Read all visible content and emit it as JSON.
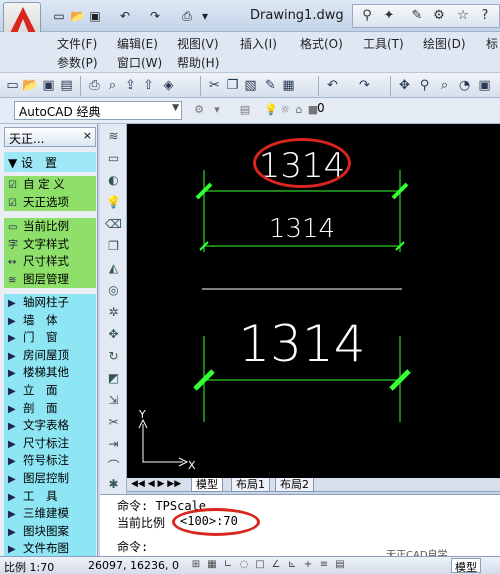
{
  "app": {
    "logo": "autocad-logo-icon",
    "document_title": "Drawing1.dwg"
  },
  "quick_access": [
    "new-icon",
    "open-icon",
    "save-icon",
    "undo-icon",
    "redo-icon",
    "plot-icon"
  ],
  "help_tools": [
    "binoculars-icon",
    "sync-icon",
    "tools-icon",
    "star-icon",
    "help-icon"
  ],
  "menu": {
    "row1": [
      "文件(F)",
      "编辑(E)",
      "视图(V)",
      "插入(I)",
      "格式(O)",
      "工具(T)",
      "绘图(D)",
      "标"
    ],
    "row2": [
      "参数(P)",
      "窗口(W)",
      "帮助(H)"
    ]
  },
  "workspace": {
    "selected": "AutoCAD 经典",
    "layer_value": "0"
  },
  "tianzheng": {
    "title": "天正...",
    "settings_header": "设　置",
    "settings_items": [
      "自 定 义",
      "天正选项",
      "当前比例",
      "文字样式",
      "尺寸样式",
      "图层管理"
    ],
    "groups": [
      "轴网柱子",
      "墙　体",
      "门　窗",
      "房间屋顶",
      "楼梯其他",
      "立　面",
      "剖　面",
      "文字表格",
      "尺寸标注",
      "符号标注",
      "图层控制",
      "工　具",
      "三维建模",
      "图块图案",
      "文件布图"
    ]
  },
  "drawing": {
    "texts": [
      "1314",
      "1314",
      "1314"
    ],
    "ucs": {
      "x_label": "X",
      "y_label": "Y"
    },
    "colors": {
      "background": "#000000",
      "dim_line": "#33ff33",
      "text": "#ffffff",
      "highlight": "#d9251d"
    }
  },
  "tabs": [
    "模型",
    "布局1",
    "布局2"
  ],
  "command": {
    "line1": "命令: TPScale",
    "line2_prefix": "当前比例",
    "line2_value": "<100>:70",
    "line3": "命令:"
  },
  "watermark": "天正CAD自学",
  "status": {
    "scale": "比例 1:70",
    "coords": "26097, 16236, 0",
    "mode": "模型"
  }
}
